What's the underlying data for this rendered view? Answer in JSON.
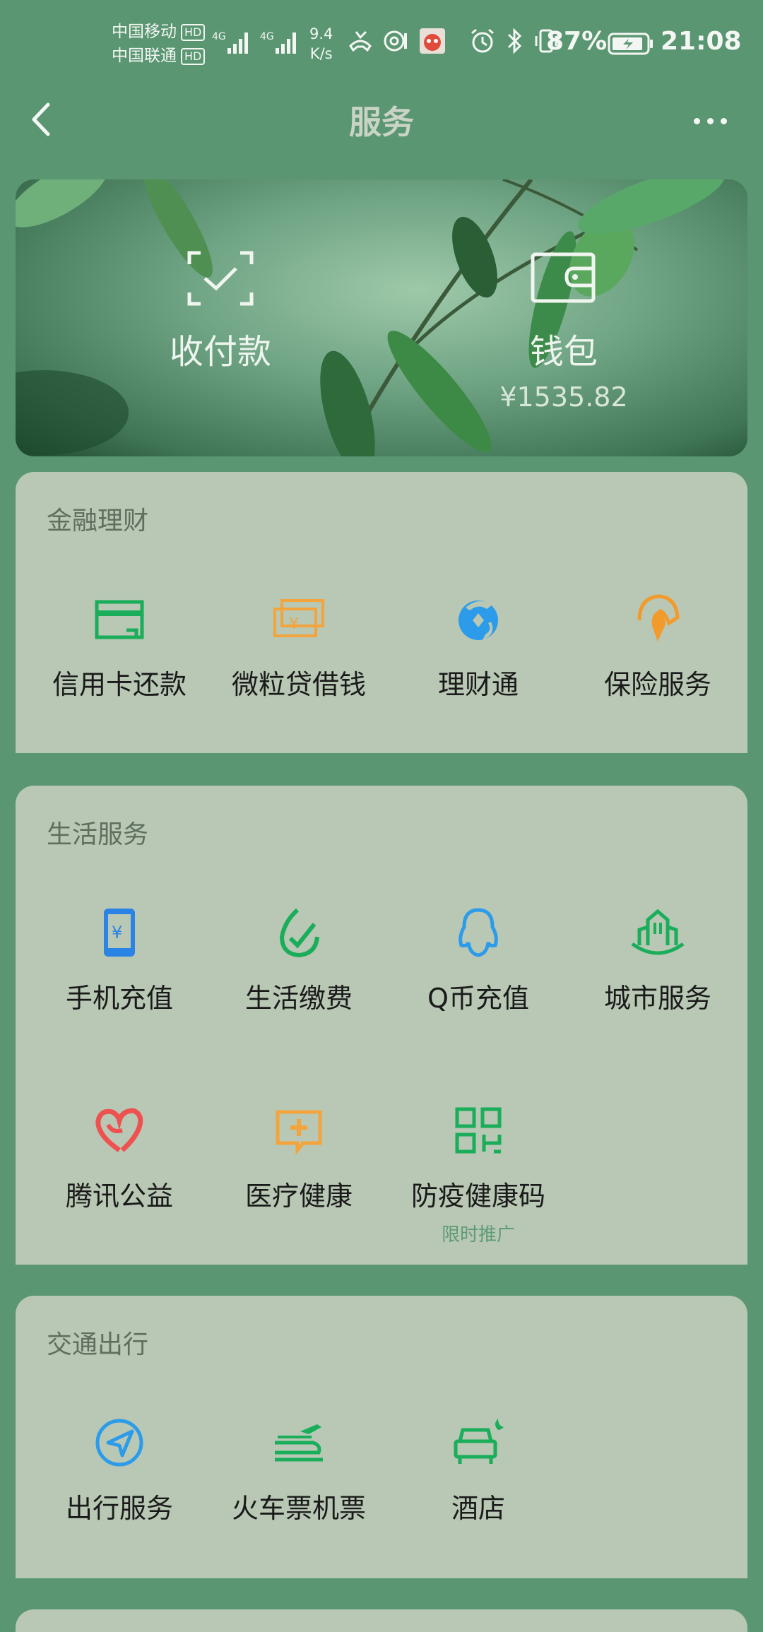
{
  "status_bar": {
    "carrier1": "中国移动",
    "carrier2": "中国联通",
    "hd": "HD",
    "net_type": "4G",
    "net_speed_value": "9.4",
    "net_speed_unit": "K/s",
    "battery_percent": "87%",
    "time": "21:08"
  },
  "header": {
    "title": "服务"
  },
  "banner": {
    "pay": {
      "label": "收付款",
      "icon": "scan-check-icon"
    },
    "wallet": {
      "label": "钱包",
      "amount": "¥1535.82",
      "icon": "wallet-icon"
    }
  },
  "sections": {
    "finance": {
      "title": "金融理财",
      "items": [
        {
          "label": "信用卡还款",
          "icon": "credit-card-icon",
          "color": "#1aad5a"
        },
        {
          "label": "微粒贷借钱",
          "icon": "cash-stack-icon",
          "color": "#f3a43c"
        },
        {
          "label": "理财通",
          "icon": "wealth-circle-icon",
          "color": "#2b9bea"
        },
        {
          "label": "保险服务",
          "icon": "umbrella-icon",
          "color": "#f39a2c"
        }
      ]
    },
    "life": {
      "title": "生活服务",
      "items": [
        {
          "label": "手机充值",
          "icon": "phone-recharge-icon",
          "color": "#2b83e6"
        },
        {
          "label": "生活缴费",
          "icon": "leaf-check-icon",
          "color": "#1aad5a"
        },
        {
          "label": "Q币充值",
          "icon": "penguin-icon",
          "color": "#2b9bea"
        },
        {
          "label": "城市服务",
          "icon": "city-icon",
          "color": "#1aad5a"
        },
        {
          "label": "腾讯公益",
          "icon": "heart-icon",
          "color": "#ef5050"
        },
        {
          "label": "医疗健康",
          "icon": "medical-plus-icon",
          "color": "#f3a43c"
        },
        {
          "label": "防疫健康码",
          "icon": "qr-code-icon",
          "color": "#1aad5a",
          "sub": "限时推广"
        }
      ]
    },
    "transport": {
      "title": "交通出行",
      "items": [
        {
          "label": "出行服务",
          "icon": "navigation-icon",
          "color": "#2b9bea"
        },
        {
          "label": "火车票机票",
          "icon": "train-plane-icon",
          "color": "#1aad5a"
        },
        {
          "label": "酒店",
          "icon": "hotel-bed-icon",
          "color": "#1aad5a"
        }
      ]
    }
  }
}
